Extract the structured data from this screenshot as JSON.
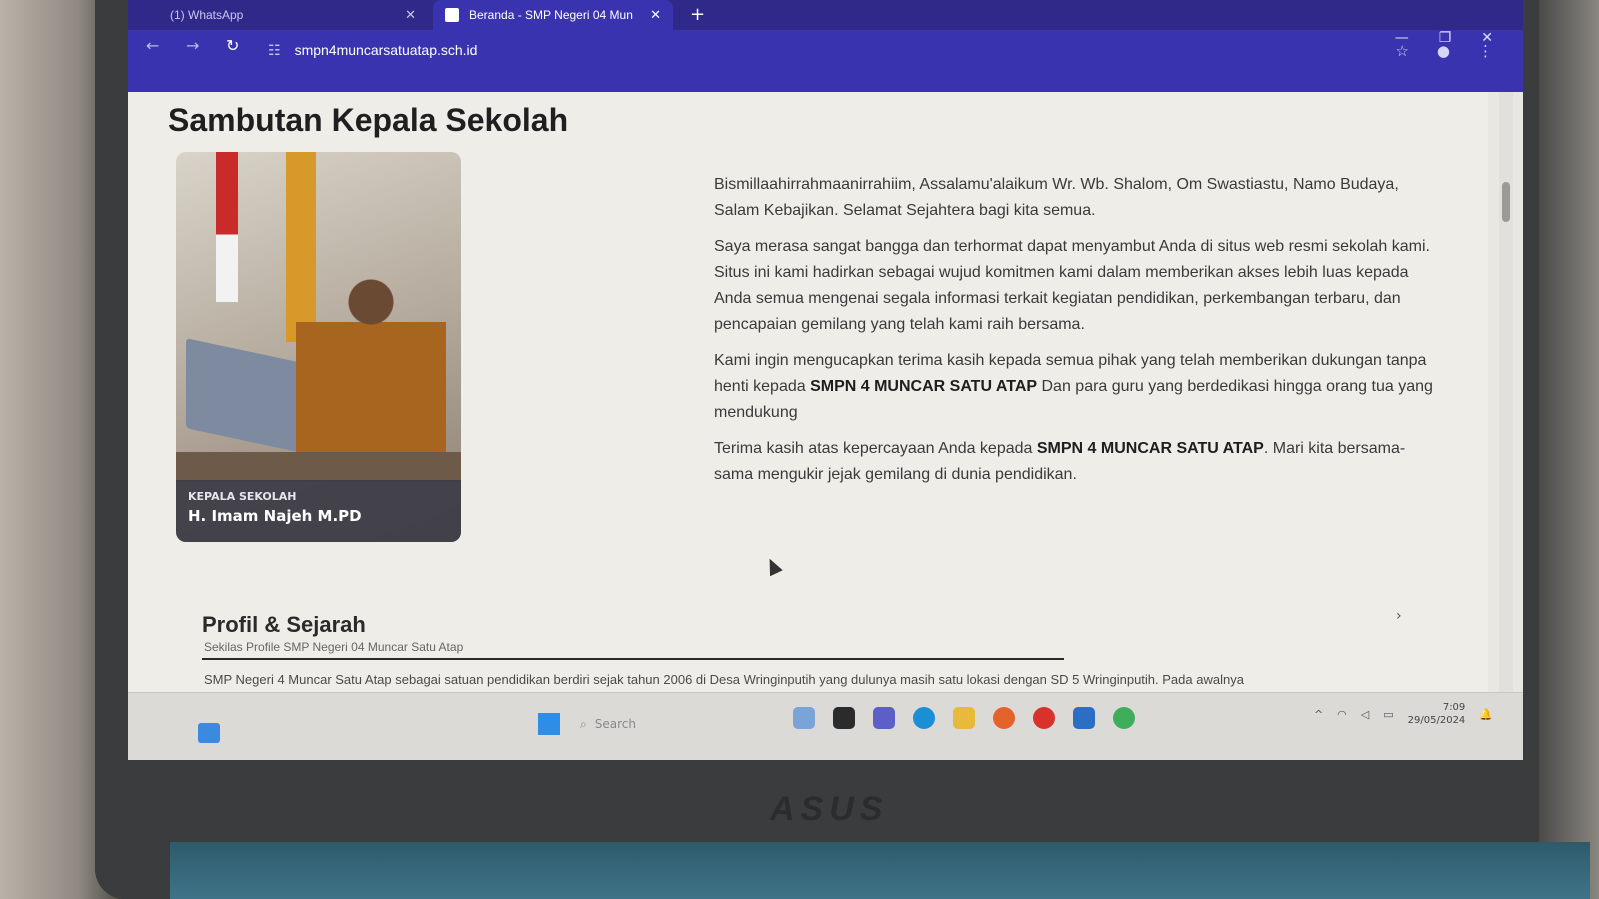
{
  "browser": {
    "tabs": [
      {
        "label": "(1) WhatsApp"
      },
      {
        "label": "Beranda - SMP Negeri 04 Mun"
      }
    ],
    "url": "smpn4muncarsatuatap.sch.id"
  },
  "page": {
    "title": "Sambutan Kepala Sekolah",
    "photo_caption": {
      "role": "KEPALA SEKOLAH",
      "name": "H. Imam Najeh M.PD"
    },
    "paragraphs": {
      "p1": "Bismillaahirrahmaanirrahiim, Assalamu'alaikum Wr. Wb. Shalom, Om Swastiastu, Namo Budaya, Salam Kebajikan. Selamat Sejahtera bagi kita semua.",
      "p2": "Saya merasa sangat bangga dan terhormat dapat menyambut Anda di situs web resmi sekolah kami. Situs ini kami hadirkan sebagai wujud komitmen kami dalam memberikan akses lebih luas kepada Anda semua mengenai segala informasi terkait kegiatan pendidikan, perkembangan terbaru, dan pencapaian gemilang yang telah kami raih bersama.",
      "p3_before": "Kami ingin mengucapkan terima kasih kepada semua pihak yang telah memberikan dukungan tanpa henti kepada ",
      "p3_strong": "SMPN 4 MUNCAR SATU ATAP",
      "p3_after": " Dan para guru yang berdedikasi hingga orang tua yang mendukung",
      "p4_before": "Terima kasih atas kepercayaan Anda kepada ",
      "p4_strong": "SMPN 4 MUNCAR SATU ATAP",
      "p4_after": ". Mari kita bersama-sama mengukir jejak gemilang di dunia pendidikan."
    },
    "profile": {
      "title": "Profil & Sejarah",
      "subtitle": "Sekilas Profile SMP Negeri 04 Muncar Satu Atap",
      "body": "SMP Negeri 4 Muncar Satu Atap sebagai satuan pendidikan berdiri sejak tahun 2006 di Desa Wringinputih yang dulunya masih satu lokasi dengan SD 5 Wringinputih. Pada awalnya"
    }
  },
  "taskbar": {
    "search_placeholder": "Search",
    "time": "7:09",
    "date": "29/05/2024"
  },
  "laptop_brand": "ASUS",
  "colors": {
    "browser_accent": "#3a33b0",
    "tabbar": "#2f2a8a",
    "page_bg": "#efede8"
  }
}
